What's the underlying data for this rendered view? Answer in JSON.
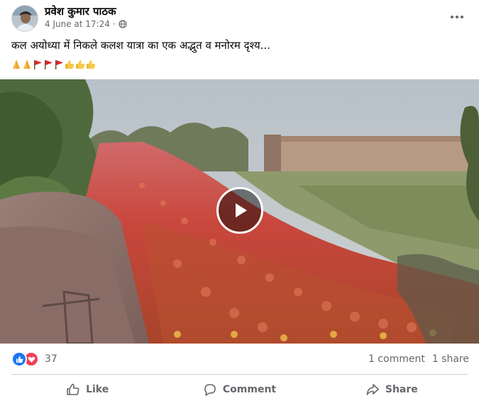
{
  "post": {
    "author": "प्रवेश कुमार पाठक",
    "date": "4 June at 17:24",
    "separator": "·",
    "caption": "कल अयोध्या में निकले कलश यात्रा का एक अद्भुत व मनोरम दृश्य...",
    "emojis": [
      "folded-hands",
      "folded-hands",
      "red-flag",
      "red-flag",
      "red-flag",
      "thumbs-up",
      "thumbs-up",
      "thumbs-up"
    ]
  },
  "reactions": {
    "icons": [
      "like-icon",
      "love-icon"
    ],
    "count": "37",
    "comments": "1 comment",
    "shares": "1 share"
  },
  "actions": {
    "like": "Like",
    "comment": "Comment",
    "share": "Share"
  },
  "colors": {
    "like_blue": "#1877f2",
    "love_red": "#f33e58",
    "secondary_text": "#65676b"
  }
}
